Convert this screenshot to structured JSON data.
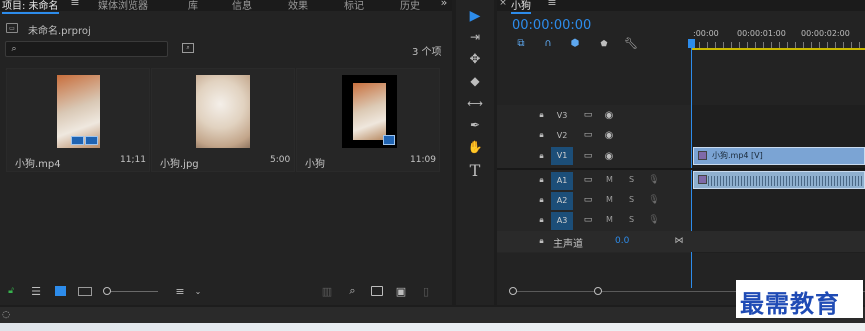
{
  "project_tabs": [
    "项目: 未命名",
    "媒体浏览器",
    "库",
    "信息",
    "效果",
    "标记",
    "历史"
  ],
  "project_file": "未命名.prproj",
  "item_count": "3 个项",
  "search_placeholder": "",
  "assets": [
    {
      "name": "小狗.mp4",
      "duration": "11;11"
    },
    {
      "name": "小狗.jpg",
      "duration": "5:00"
    },
    {
      "name": "小狗",
      "duration": "11:09"
    }
  ],
  "sequence": {
    "tab": "小狗",
    "timecode": "00:00:00:00",
    "ruler": [
      ":00:00",
      "00:00:01:00",
      "00:00:02:00"
    ]
  },
  "video_tracks": [
    {
      "label": "V3",
      "active": false
    },
    {
      "label": "V2",
      "active": false
    },
    {
      "label": "V1",
      "active": true
    }
  ],
  "audio_tracks": [
    {
      "label": "A1",
      "m": "M",
      "s": "S"
    },
    {
      "label": "A2",
      "m": "M",
      "s": "S"
    },
    {
      "label": "A3",
      "m": "M",
      "s": "S"
    }
  ],
  "master": {
    "label": "主声道",
    "value": "0.0"
  },
  "clip_video": "小狗.mp4 [V]",
  "watermark": "最需教育",
  "colors": {
    "accent": "#2d8ceb",
    "clip_video": "#7ba4d4",
    "clip_audio": "#8fb0cf",
    "track_active": "#1c4e78"
  }
}
